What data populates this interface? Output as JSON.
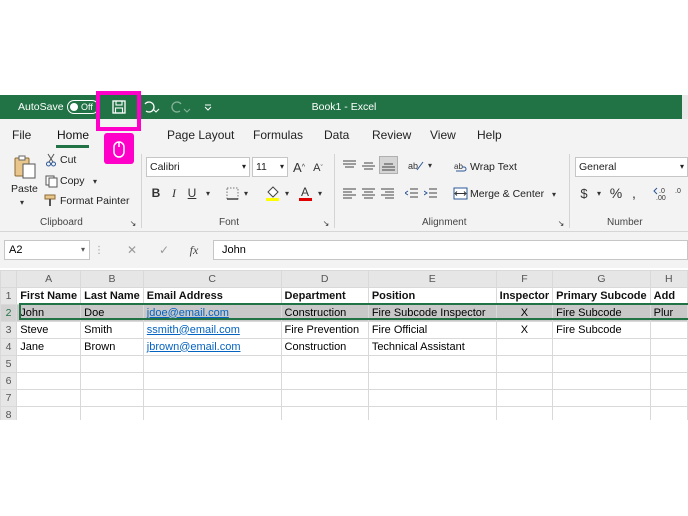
{
  "titlebar": {
    "autosave_label": "AutoSave",
    "autosave_state": "Off",
    "document_title": "Book1  -  Excel",
    "accent_color": "#217346",
    "icons": [
      "save-icon",
      "undo-icon",
      "redo-icon",
      "customize-qat-icon"
    ]
  },
  "highlight_color": "#ff00c8",
  "tabs": [
    {
      "label": "File"
    },
    {
      "label": "Home",
      "active": true
    },
    {
      "label": "Page Layout"
    },
    {
      "label": "Formulas"
    },
    {
      "label": "Data"
    },
    {
      "label": "Review"
    },
    {
      "label": "View"
    },
    {
      "label": "Help"
    }
  ],
  "ribbon": {
    "clipboard": {
      "paste": "Paste",
      "cut": "Cut",
      "copy": "Copy",
      "format_painter": "Format Painter",
      "label": "Clipboard"
    },
    "font": {
      "name": "Calibri",
      "size": "11",
      "bold": "B",
      "italic": "I",
      "underline": "U",
      "label": "Font"
    },
    "alignment": {
      "wrap_text": "Wrap Text",
      "merge_center": "Merge & Center",
      "label": "Alignment"
    },
    "number": {
      "format": "General",
      "label": "Number"
    }
  },
  "formula_bar": {
    "name_box": "A2",
    "cancel": "✕",
    "enter": "✓",
    "fx": "fx",
    "content": "John"
  },
  "sheet": {
    "columns": [
      "A",
      "B",
      "C",
      "D",
      "E",
      "F",
      "G",
      "H"
    ],
    "row_numbers": [
      "1",
      "2",
      "3",
      "4",
      "5",
      "6",
      "7",
      "8"
    ],
    "header": [
      "First Name",
      "Last Name",
      "Email Address",
      "Department",
      "Position",
      "Inspector",
      "Primary Subcode",
      "Add"
    ],
    "rows": [
      [
        "John",
        "Doe",
        "jdoe@email.com",
        "Construction",
        "Fire Subcode Inspector",
        "X",
        "Fire Subcode",
        "Plur"
      ],
      [
        "Steve",
        "Smith",
        "ssmith@email.com",
        "Fire Prevention",
        "Fire Official",
        "X",
        "Fire Subcode",
        ""
      ],
      [
        "Jane",
        "Brown",
        "jbrown@email.com",
        "Construction",
        "Technical Assistant",
        "",
        "",
        ""
      ],
      [
        "",
        "",
        "",
        "",
        "",
        "",
        "",
        ""
      ],
      [
        "",
        "",
        "",
        "",
        "",
        "",
        "",
        ""
      ],
      [
        "",
        "",
        "",
        "",
        "",
        "",
        "",
        ""
      ],
      [
        "",
        "",
        "",
        "",
        "",
        "",
        "",
        ""
      ]
    ]
  }
}
